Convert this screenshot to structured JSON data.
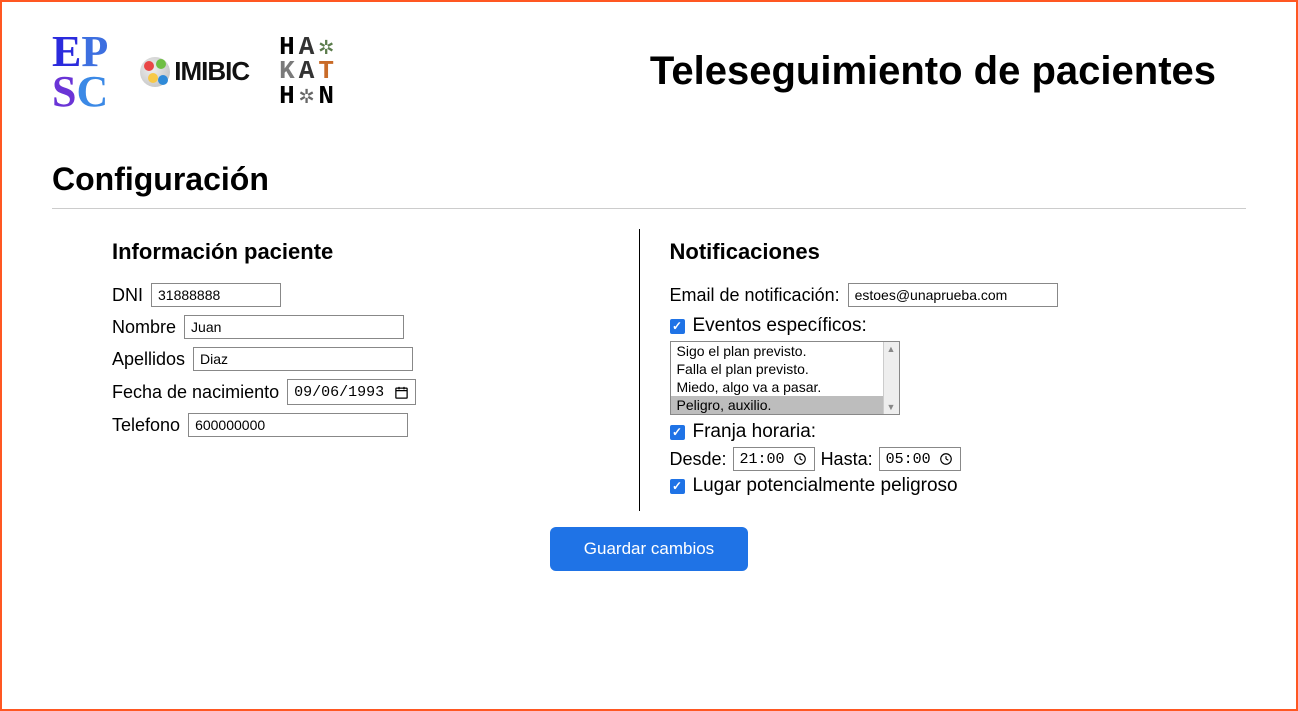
{
  "header": {
    "title": "Teleseguimiento de pacientes",
    "logos": {
      "epsc": {
        "line1": "EP",
        "line2": "SC"
      },
      "imibic": "IMIBIC",
      "hackathon": {
        "l1": "HA",
        "l2": "KAT",
        "l3": "H",
        "l3b": "N"
      }
    }
  },
  "section": {
    "title": "Configuración"
  },
  "patient": {
    "panel_title": "Información paciente",
    "dni_label": "DNI",
    "dni_value": "31888888",
    "nombre_label": "Nombre",
    "nombre_value": "Juan",
    "apellidos_label": "Apellidos",
    "apellidos_value": "Diaz",
    "fnac_label": "Fecha de nacimiento",
    "fnac_value": "09/06/1993",
    "telefono_label": "Telefono",
    "telefono_value": "600000000"
  },
  "notifications": {
    "panel_title": "Notificaciones",
    "email_label": "Email de notificación:",
    "email_value": "estoes@unaprueba.com",
    "eventos_label": "Eventos específicos:",
    "eventos_checked": true,
    "eventos_options": [
      {
        "label": "Sigo el plan previsto.",
        "selected": false
      },
      {
        "label": "Falla el plan previsto.",
        "selected": false
      },
      {
        "label": "Miedo, algo va a pasar.",
        "selected": false
      },
      {
        "label": "Peligro, auxilio.",
        "selected": true
      }
    ],
    "franja_label": "Franja horaria:",
    "franja_checked": true,
    "desde_label": "Desde:",
    "desde_value": "21:00",
    "hasta_label": "Hasta:",
    "hasta_value": "05:00",
    "lugar_label": "Lugar potencialmente peligroso",
    "lugar_checked": true
  },
  "actions": {
    "save_label": "Guardar cambios"
  },
  "colors": {
    "accent": "#1f73e6",
    "border": "#ff5722"
  }
}
